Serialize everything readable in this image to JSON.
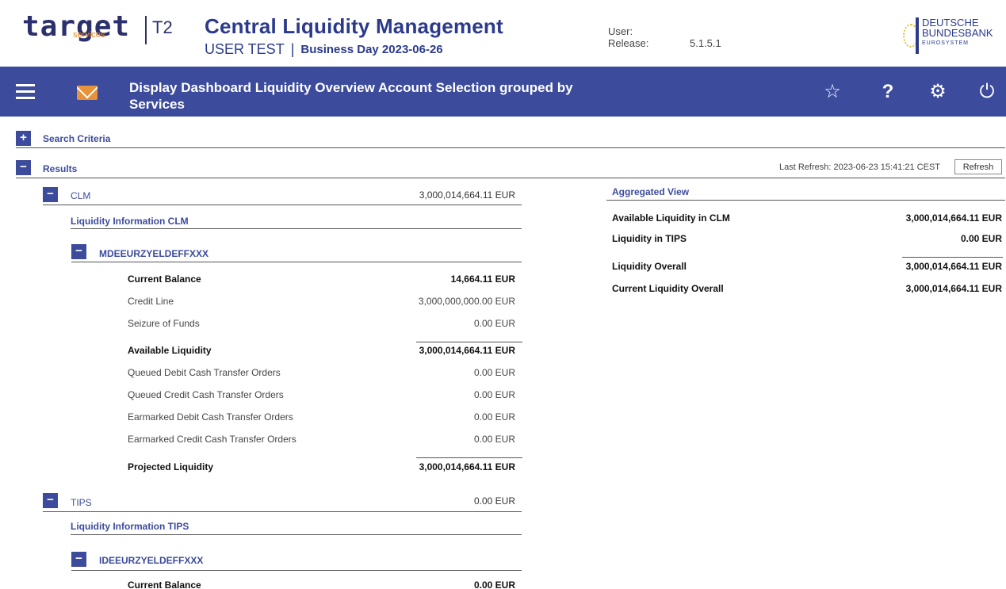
{
  "header": {
    "logo_word": "target",
    "logo_sub": "services",
    "logo_t2": "T2",
    "app_title": "Central Liquidity Management",
    "environment": "USER TEST",
    "business_day": "Business Day 2023-06-26",
    "user_label": "User:",
    "release_label": "Release:",
    "release_value": "5.1.5.1",
    "bank_line1": "DEUTSCHE",
    "bank_line2": "BUNDESBANK",
    "bank_line3": "EUROSYSTEM"
  },
  "navbar": {
    "title": "Display Dashboard Liquidity Overview Account Selection grouped by Services",
    "icons": [
      "menu-icon",
      "mail-icon",
      "star-icon",
      "help-icon",
      "gear-icon",
      "power-icon"
    ]
  },
  "search_criteria": {
    "label": "Search Criteria",
    "toggle": "+"
  },
  "results": {
    "label": "Results",
    "toggle": "−",
    "last_refresh": "Last Refresh: 2023-06-23 15:41:21 CEST",
    "refresh_button": "Refresh"
  },
  "clm": {
    "label": "CLM",
    "total": "3,000,014,664.11 EUR",
    "info_label": "Liquidity Information CLM",
    "account": "MDEEURZYELDEFFXXX",
    "rows": [
      {
        "label": "Current Balance",
        "value": "14,664.11 EUR",
        "bold": true
      },
      {
        "label": "Credit Line",
        "value": "3,000,000,000.00 EUR",
        "bold": false
      },
      {
        "label": "Seizure of Funds",
        "value": "0.00 EUR",
        "bold": false
      },
      {
        "label": "Available Liquidity",
        "value": "3,000,014,664.11 EUR",
        "bold": true
      },
      {
        "label": "Queued Debit Cash Transfer Orders",
        "value": "0.00 EUR",
        "bold": false
      },
      {
        "label": "Queued Credit Cash Transfer Orders",
        "value": "0.00 EUR",
        "bold": false
      },
      {
        "label": "Earmarked Debit Cash Transfer Orders",
        "value": "0.00 EUR",
        "bold": false
      },
      {
        "label": "Earmarked Credit Cash Transfer Orders",
        "value": "0.00 EUR",
        "bold": false
      },
      {
        "label": "Projected Liquidity",
        "value": "3,000,014,664.11 EUR",
        "bold": true
      }
    ]
  },
  "tips": {
    "label": "TIPS",
    "total": "0.00 EUR",
    "info_label": "Liquidity Information TIPS",
    "account": "IDEEURZYELDEFFXXX",
    "rows": [
      {
        "label": "Current Balance",
        "value": "0.00 EUR",
        "bold": true
      }
    ]
  },
  "aggregated": {
    "label": "Aggregated View",
    "rows": [
      {
        "label": "Available Liquidity in CLM",
        "value": "3,000,014,664.11 EUR"
      },
      {
        "label": "Liquidity in TIPS",
        "value": "0.00 EUR"
      },
      {
        "label": "Liquidity Overall",
        "value": "3,000,014,664.11 EUR"
      },
      {
        "label": "Current Liquidity Overall",
        "value": "3,000,014,664.11 EUR"
      }
    ]
  },
  "colors": {
    "navbar": "#3c4b9c",
    "brand": "#2b3a8c",
    "accent": "#e8923a"
  }
}
